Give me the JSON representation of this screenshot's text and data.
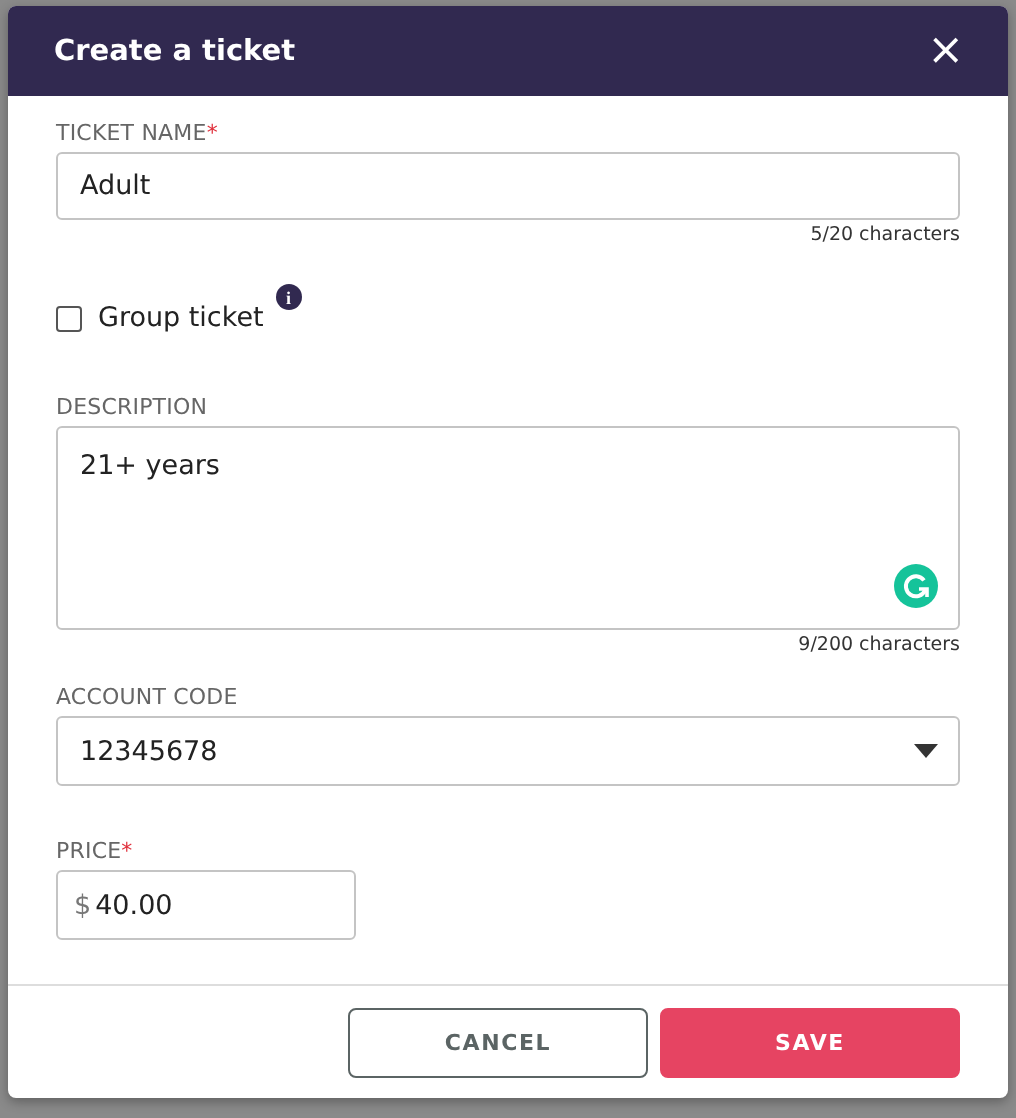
{
  "dialog": {
    "title": "Create a ticket",
    "close": "×"
  },
  "fields": [
    {
      "kind": "text",
      "label": "TICKET NAME",
      "required_mark": "*",
      "value": "Adult",
      "counter": "5/20 characters"
    },
    {
      "kind": "checkbox",
      "label": "Group ticket",
      "checked": false,
      "info": "i"
    },
    {
      "kind": "textarea",
      "label": "DESCRIPTION",
      "value": "21+ years",
      "counter": "9/200 characters"
    },
    {
      "kind": "select",
      "label": "ACCOUNT CODE",
      "value": "12345678"
    },
    {
      "kind": "money",
      "label": "PRICE",
      "required_mark": "*",
      "prefix": "$",
      "value": "40.00"
    }
  ],
  "buttons": [
    {
      "kind": "secondary",
      "label": "CANCEL"
    },
    {
      "kind": "primary",
      "label": "SAVE"
    }
  ]
}
